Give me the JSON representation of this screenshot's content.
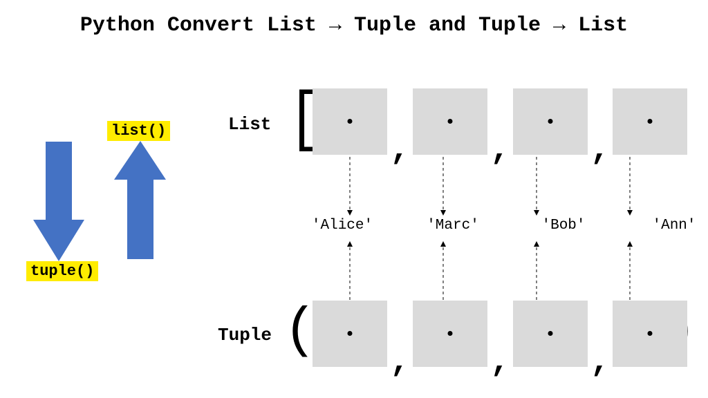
{
  "title_parts": {
    "p1": "Python Convert List ",
    "arrow": "→",
    "p2": " Tuple and Tuple ",
    "p3": " List"
  },
  "functions": {
    "list": "list()",
    "tuple": "tuple()"
  },
  "row_labels": {
    "list": "List",
    "tuple": "Tuple"
  },
  "values": [
    "'Alice'",
    "'Marc'",
    "'Bob'",
    "'Ann'"
  ],
  "brackets": {
    "sq_open": "[",
    "sq_close": "]",
    "paren_open": "(",
    "paren_close": ")"
  },
  "comma": ","
}
